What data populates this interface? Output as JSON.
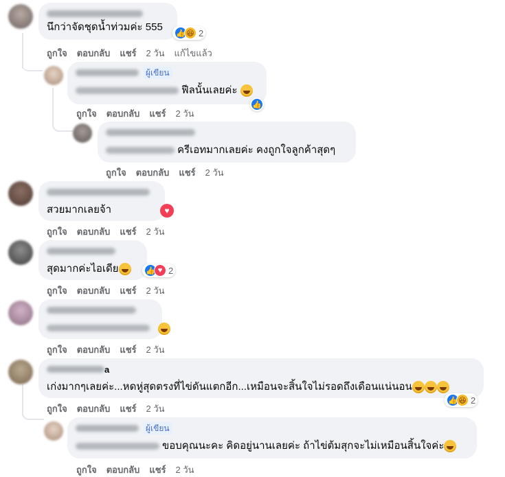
{
  "actions": {
    "like": "ถูกใจ",
    "reply": "ตอบกลับ",
    "share": "แชร์",
    "edited": "แก้ไขแล้ว"
  },
  "author_badge": "ผู้เขียน",
  "comments": [
    {
      "text": "นึกว่าจัดชุดน้ำท่วมค่ะ 555",
      "time": "2 วัน",
      "reaction_count": "2",
      "edited": true
    },
    {
      "text": "ฟีลนั้นเลยค่ะ",
      "time": "2 วัน"
    },
    {
      "text": "ครีเอทมากเลยค่ะ คงถูกใจลูกค้าสุดๆ",
      "time": "2 วัน"
    },
    {
      "text": "สวยมากเลยจ้า",
      "time": "2 วัน"
    },
    {
      "text": "สุดมากค่ะไอเดีย",
      "time": "2 วัน",
      "reaction_count": "2"
    },
    {
      "text": "",
      "time": "2 วัน"
    },
    {
      "name_suffix": "a",
      "text": "เก่งมากๆเลยค่ะ...หดหู่สุดตรงที่ไข่ดันแตกอีก...เหมือนจะสิ้นใจไม่รอดถึงเดือนแน่นอน",
      "time": "2 วัน",
      "reaction_count": "2"
    },
    {
      "text": "ขอบคุณนะคะ คิดอยู่นานเลยค่ะ ถ้าไข่ต้มสุกจะไม่เหมือนสิ้นใจค่ะ",
      "time": "2 วัน"
    }
  ],
  "colors": {
    "bubble": "#f0f2f5",
    "meta": "#65676b",
    "like": "#1877f2",
    "love": "#f33e58",
    "haha": "#f7b928"
  }
}
